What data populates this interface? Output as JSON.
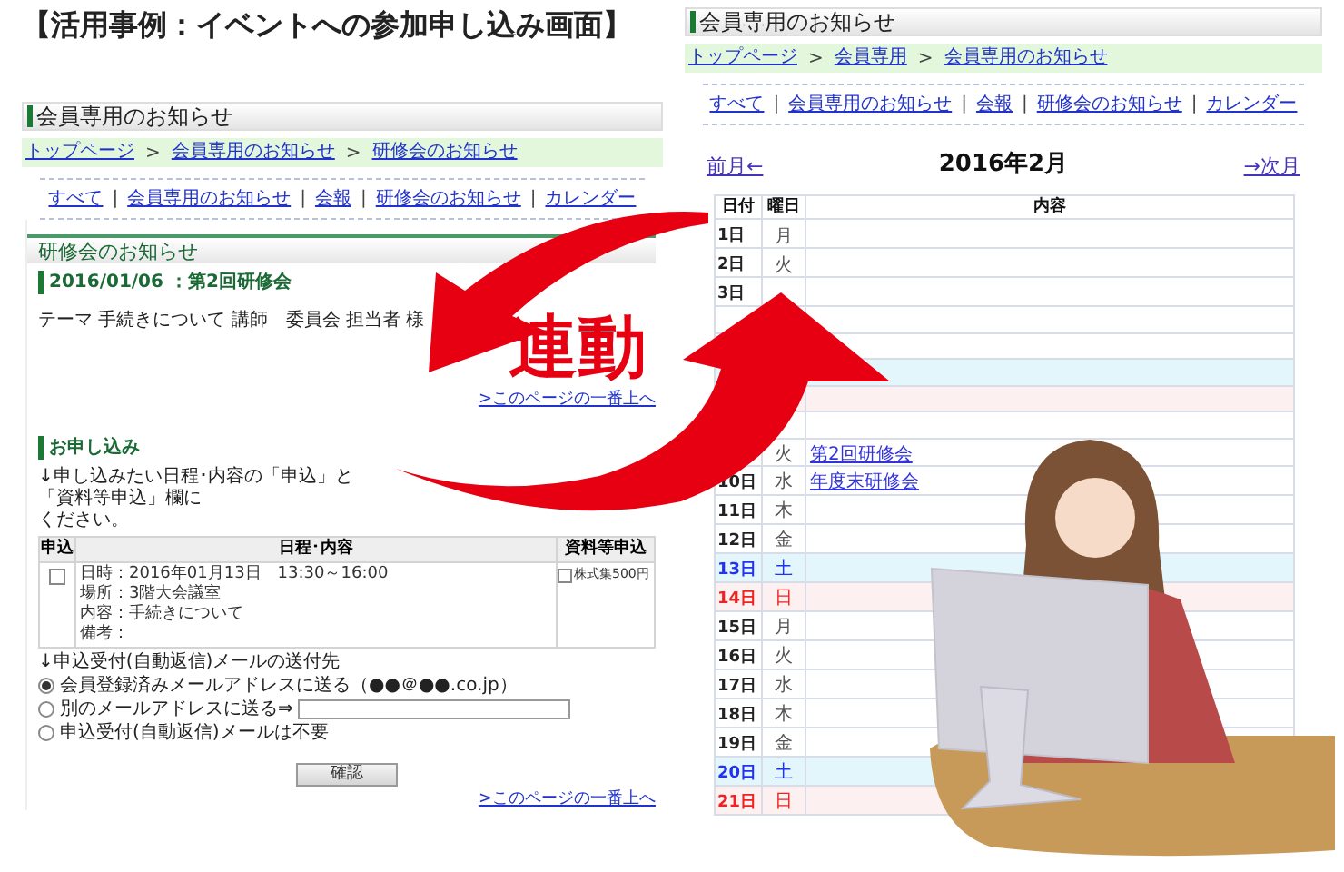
{
  "page_title": "【活用事例：イベントへの参加申し込み画面】",
  "left_screen": {
    "heading": "会員専用のお知らせ",
    "breadcrumb": {
      "separator": ">",
      "items": [
        "トップページ",
        "会員専用のお知らせ",
        "研修会のお知らせ"
      ]
    },
    "nav": {
      "separator": "|",
      "items": [
        "すべて",
        "会員専用のお知らせ",
        "会報",
        "研修会のお知らせ",
        "カレンダー"
      ]
    },
    "section_title": "研修会のお知らせ",
    "event_title": "2016/01/06 ：第2回研修会",
    "event_body": "テーマ 手続きについて 講師　委員会 担当者 様",
    "top_link": ">このページの一番上へ",
    "form": {
      "heading": "お申し込み",
      "instructions": "↓申し込みたい日程･内容の「申込」と「資料等申込」欄に",
      "instructions_end": "ください。",
      "table": {
        "columns": [
          "申込",
          "日程･内容",
          "資料等申込"
        ],
        "rows": [
          {
            "checked": false,
            "details": [
              "日時：2016年01月13日　13:30～16:00",
              "場所：3階大会議室",
              "内容：手続きについて",
              "備考："
            ],
            "material": {
              "label": "株式集500円",
              "checked": false
            }
          }
        ]
      },
      "mail_heading": "↓申込受付(自動返信)メールの送付先",
      "mail_options": [
        {
          "kind": "plain",
          "label": "会員登録済みメールアドレスに送る（●●＠●●.co.jp）",
          "selected": true
        },
        {
          "kind": "input",
          "label": "別のメールアドレスに送る⇒",
          "selected": false
        },
        {
          "kind": "plain",
          "label": "申込受付(自動返信)メールは不要",
          "selected": false
        }
      ],
      "confirm_button": "確認",
      "bottom_link": ">このページの一番上へ"
    }
  },
  "right_screen": {
    "heading": "会員専用のお知らせ",
    "breadcrumb": {
      "separator": ">",
      "items": [
        "トップページ",
        "会員専用",
        "会員専用のお知らせ"
      ]
    },
    "nav": {
      "separator": "|",
      "items": [
        "すべて",
        "会員専用のお知らせ",
        "会報",
        "研修会のお知らせ",
        "カレンダー"
      ]
    },
    "calendar": {
      "prev": "前月←",
      "title": "2016年2月",
      "next": "→次月",
      "columns": [
        "日付",
        "曜日",
        "内容"
      ],
      "rows": [
        {
          "day": "1日",
          "weekday": "月",
          "kind": "weekday"
        },
        {
          "day": "2日",
          "weekday": "火",
          "kind": "weekday"
        },
        {
          "day": "3日",
          "kind": "weekday"
        },
        {
          "kind": "weekday"
        },
        {
          "kind": "weekday"
        },
        {
          "kind": "saturday"
        },
        {
          "kind": "sunday"
        },
        {
          "kind": "weekday"
        },
        {
          "weekday": "火",
          "kind": "weekday",
          "events": [
            "第2回研修会"
          ]
        },
        {
          "day": "10日",
          "weekday": "水",
          "kind": "weekday",
          "events": [
            "年度末研修会"
          ]
        },
        {
          "day": "11日",
          "weekday": "木",
          "kind": "weekday"
        },
        {
          "day": "12日",
          "weekday": "金",
          "kind": "weekday"
        },
        {
          "day": "13日",
          "weekday": "土",
          "kind": "saturday"
        },
        {
          "day": "14日",
          "weekday": "日",
          "kind": "sunday"
        },
        {
          "day": "15日",
          "weekday": "月",
          "kind": "weekday"
        },
        {
          "day": "16日",
          "weekday": "火",
          "kind": "weekday"
        },
        {
          "day": "17日",
          "weekday": "水",
          "kind": "weekday"
        },
        {
          "day": "18日",
          "weekday": "木",
          "kind": "weekday"
        },
        {
          "day": "19日",
          "weekday": "金",
          "kind": "weekday"
        },
        {
          "day": "20日",
          "weekday": "土",
          "kind": "saturday"
        },
        {
          "day": "21日",
          "weekday": "日",
          "kind": "sunday"
        }
      ]
    }
  },
  "linked_label": "連動"
}
